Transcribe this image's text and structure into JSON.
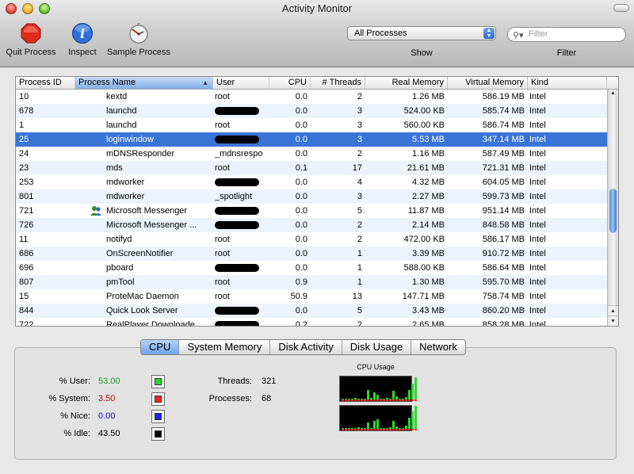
{
  "window": {
    "title": "Activity Monitor"
  },
  "toolbar": {
    "quit_label": "Quit Process",
    "inspect_label": "Inspect",
    "sample_label": "Sample Process",
    "show_value": "All Processes",
    "show_label": "Show",
    "filter_placeholder": "Filter",
    "filter_label": "Filter"
  },
  "table": {
    "headers": [
      "Process ID",
      "Process Name",
      "User",
      "CPU",
      "# Threads",
      "Real Memory",
      "Virtual Memory",
      "Kind"
    ],
    "rows": [
      {
        "pid": "10",
        "name": "kextd",
        "user": "root",
        "cpu": "0.0",
        "threads": "2",
        "real": "1.26 MB",
        "virtual": "586.19 MB",
        "kind": "Intel"
      },
      {
        "pid": "678",
        "name": "launchd",
        "user": "",
        "cpu": "0.0",
        "threads": "3",
        "real": "524.00 KB",
        "virtual": "585.74 MB",
        "kind": "Intel"
      },
      {
        "pid": "1",
        "name": "launchd",
        "user": "root",
        "cpu": "0.0",
        "threads": "3",
        "real": "560.00 KB",
        "virtual": "586.74 MB",
        "kind": "Intel"
      },
      {
        "pid": "25",
        "name": "loginwindow",
        "user": "",
        "cpu": "0.0",
        "threads": "3",
        "real": "5.53 MB",
        "virtual": "347.14 MB",
        "kind": "Intel"
      },
      {
        "pid": "24",
        "name": "mDNSResponder",
        "user": "_mdnsrespo",
        "cpu": "0.0",
        "threads": "2",
        "real": "1.16 MB",
        "virtual": "587.49 MB",
        "kind": "Intel"
      },
      {
        "pid": "23",
        "name": "mds",
        "user": "root",
        "cpu": "0.1",
        "threads": "17",
        "real": "21.61 MB",
        "virtual": "721.31 MB",
        "kind": "Intel"
      },
      {
        "pid": "253",
        "name": "mdworker",
        "user": "",
        "cpu": "0.0",
        "threads": "4",
        "real": "4.32 MB",
        "virtual": "604.05 MB",
        "kind": "Intel"
      },
      {
        "pid": "801",
        "name": "mdworker",
        "user": "_spotlight",
        "cpu": "0.0",
        "threads": "3",
        "real": "2.27 MB",
        "virtual": "599.73 MB",
        "kind": "Intel"
      },
      {
        "pid": "721",
        "name": "Microsoft Messenger",
        "user": "",
        "cpu": "0.0",
        "threads": "5",
        "real": "11.87 MB",
        "virtual": "951.14 MB",
        "kind": "Intel"
      },
      {
        "pid": "726",
        "name": "Microsoft Messenger ...",
        "user": "",
        "cpu": "0.0",
        "threads": "2",
        "real": "2.14 MB",
        "virtual": "848.58 MB",
        "kind": "Intel"
      },
      {
        "pid": "11",
        "name": "notifyd",
        "user": "root",
        "cpu": "0.0",
        "threads": "2",
        "real": "472.00 KB",
        "virtual": "586.17 MB",
        "kind": "Intel"
      },
      {
        "pid": "686",
        "name": "OnScreenNotifier",
        "user": "root",
        "cpu": "0.0",
        "threads": "1",
        "real": "3.39 MB",
        "virtual": "910.72 MB",
        "kind": "Intel"
      },
      {
        "pid": "696",
        "name": "pboard",
        "user": "",
        "cpu": "0.0",
        "threads": "1",
        "real": "588.00 KB",
        "virtual": "586.64 MB",
        "kind": "Intel"
      },
      {
        "pid": "807",
        "name": "pmTool",
        "user": "root",
        "cpu": "0.9",
        "threads": "1",
        "real": "1.30 MB",
        "virtual": "595.70 MB",
        "kind": "Intel"
      },
      {
        "pid": "15",
        "name": "ProteMac Daemon",
        "user": "root",
        "cpu": "50.9",
        "threads": "13",
        "real": "147.71 MB",
        "virtual": "758.74 MB",
        "kind": "Intel"
      },
      {
        "pid": "844",
        "name": "Quick Look Server",
        "user": "",
        "cpu": "0.0",
        "threads": "5",
        "real": "3.43 MB",
        "virtual": "860.20 MB",
        "kind": "Intel"
      },
      {
        "pid": "722",
        "name": "RealPlayer Downloade...",
        "user": "",
        "cpu": "0.2",
        "threads": "2",
        "real": "2.65 MB",
        "virtual": "858.28 MB",
        "kind": "Intel"
      }
    ]
  },
  "tabs": [
    "CPU",
    "System Memory",
    "Disk Activity",
    "Disk Usage",
    "Network"
  ],
  "cpu_panel": {
    "user_label": "% User:",
    "user_value": "53.00",
    "user_color": "#1a9a1a",
    "system_label": "% System:",
    "system_value": "3.50",
    "system_color": "#b01010",
    "nice_label": "% Nice:",
    "nice_value": "0.00",
    "nice_color": "#1010c0",
    "idle_label": "% Idle:",
    "idle_value": "43.50",
    "threads_label": "Threads:",
    "threads_value": "321",
    "processes_label": "Processes:",
    "processes_value": "68",
    "graph_title": "CPU Usage"
  }
}
